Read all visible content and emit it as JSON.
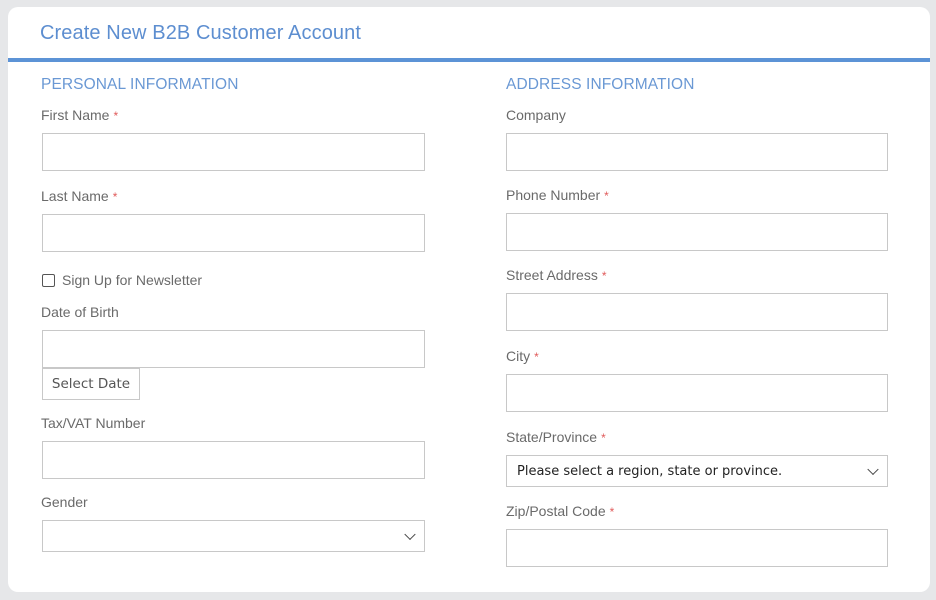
{
  "form": {
    "title": "Create New B2B Customer Account",
    "required_marker": "*"
  },
  "personal": {
    "heading": "PERSONAL INFORMATION",
    "first_name": {
      "label": "First Name",
      "value": "",
      "required": true
    },
    "last_name": {
      "label": "Last Name",
      "value": "",
      "required": true
    },
    "newsletter": {
      "label": "Sign Up for Newsletter",
      "checked": false
    },
    "dob": {
      "label": "Date of Birth",
      "value": "",
      "button": "Select Date"
    },
    "tax_vat": {
      "label": "Tax/VAT Number",
      "value": ""
    },
    "gender": {
      "label": "Gender",
      "selected": ""
    }
  },
  "address": {
    "heading": "ADDRESS INFORMATION",
    "company": {
      "label": "Company",
      "value": ""
    },
    "phone": {
      "label": "Phone Number",
      "value": "",
      "required": true
    },
    "street": {
      "label": "Street Address",
      "value": "",
      "required": true
    },
    "city": {
      "label": "City",
      "value": "",
      "required": true
    },
    "state": {
      "label": "State/Province",
      "selected": "Please select a region, state or province.",
      "required": true
    },
    "zip": {
      "label": "Zip/Postal Code",
      "value": "",
      "required": true
    }
  },
  "colors": {
    "accent": "#5c93d6",
    "required": "#e05a5a"
  }
}
